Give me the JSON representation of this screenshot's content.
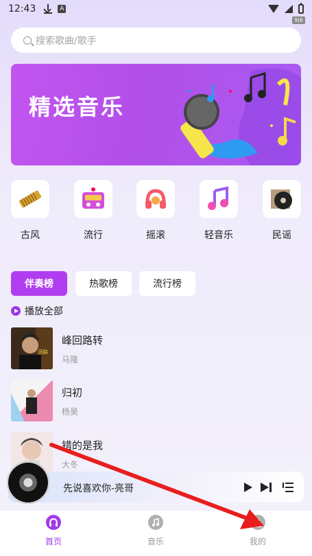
{
  "status_bar": {
    "time": "12:43",
    "badge": "9|6"
  },
  "search": {
    "placeholder": "搜索歌曲/歌手"
  },
  "banner": {
    "title": "精选音乐"
  },
  "categories": [
    {
      "label": "古风",
      "icon": "guzheng-icon"
    },
    {
      "label": "流行",
      "icon": "radio-icon"
    },
    {
      "label": "摇滚",
      "icon": "headphones-icon"
    },
    {
      "label": "轻音乐",
      "icon": "music-note-icon"
    },
    {
      "label": "民谣",
      "icon": "vinyl-icon"
    }
  ],
  "rank_tabs": [
    {
      "label": "伴奏榜",
      "active": true
    },
    {
      "label": "热歌榜",
      "active": false
    },
    {
      "label": "流行榜",
      "active": false
    }
  ],
  "play_all_label": "播放全部",
  "songs": [
    {
      "title": "峰回路转",
      "artist": "马隆"
    },
    {
      "title": "归初",
      "artist": "杨昊"
    },
    {
      "title": "错的是我",
      "artist": "大冬"
    }
  ],
  "player": {
    "now_playing": "先说喜欢你-亮哥"
  },
  "bottom_nav": [
    {
      "label": "首页",
      "active": true
    },
    {
      "label": "音乐",
      "active": false
    },
    {
      "label": "我的",
      "active": false
    }
  ],
  "colors": {
    "accent": "#a23ae8",
    "arrow": "#e81e1e"
  }
}
